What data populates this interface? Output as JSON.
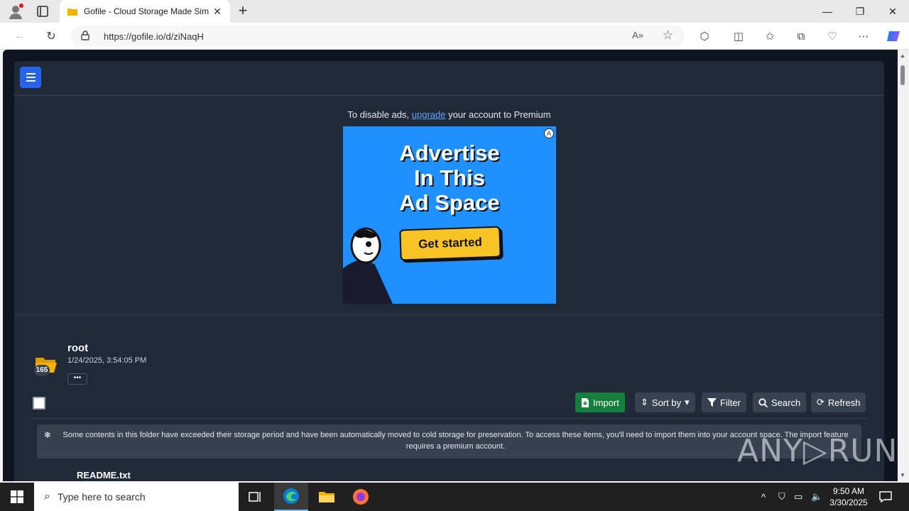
{
  "browser": {
    "tab_title": "Gofile - Cloud Storage Made Sim",
    "url": "https://gofile.io/d/ziNaqH",
    "reader_label": "A»"
  },
  "page": {
    "ad_note": {
      "before": "To disable ads, ",
      "link": "upgrade",
      "after": " your account to Premium"
    },
    "ad": {
      "headline_1": "Advertise",
      "headline_2": "In This",
      "headline_3": "Ad Space",
      "cta": "Get started"
    },
    "folder": {
      "name": "root",
      "date": "1/24/2025, 3:54:05 PM",
      "count": "165",
      "more": "•••"
    },
    "actions": {
      "import": "Import",
      "sort": "Sort by",
      "filter": "Filter",
      "search": "Search",
      "refresh": "Refresh"
    },
    "notice": "Some contents in this folder have exceeded their storage period and have been automatically moved to cold storage for preservation. To access these items, you'll need to import them into your account space. The import feature requires a premium account.",
    "first_file": "README.txt"
  },
  "watermark": "ANY▷RUN",
  "taskbar": {
    "search_placeholder": "Type here to search",
    "time": "9:50 AM",
    "date": "3/30/2025"
  },
  "colors": {
    "accent": "#2563eb",
    "import_green": "#15803d",
    "panel": "#1f2937",
    "ad_blue": "#1e90ff",
    "cta_yellow": "#f7c325"
  }
}
